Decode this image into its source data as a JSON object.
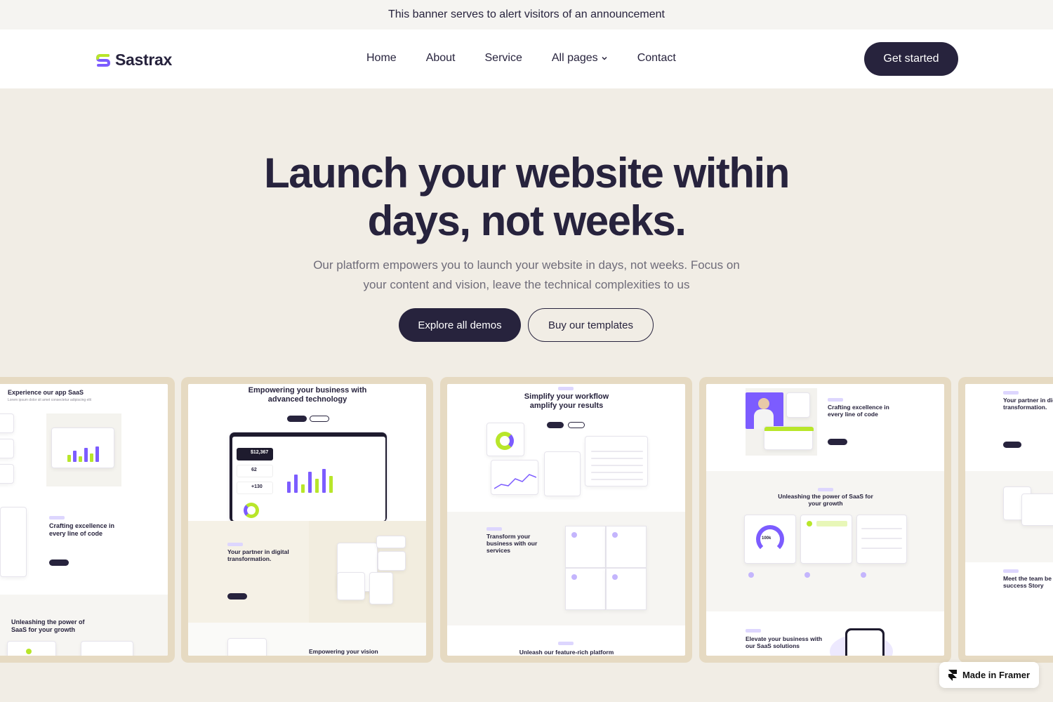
{
  "banner": {
    "text": "This banner serves to alert visitors of an announcement"
  },
  "nav": {
    "brand": "Sastrax",
    "links": [
      "Home",
      "About",
      "Service",
      "All pages",
      "Contact"
    ],
    "cta": "Get started"
  },
  "hero": {
    "title_line1": "Launch your website within",
    "title_line2": "days, not weeks.",
    "subtitle_line1": "Our platform empowers you to launch your website in days, not weeks. Focus on",
    "subtitle_line2": "your content and vision, leave the technical complexities to us",
    "primary_button": "Explore all demos",
    "secondary_button": "Buy our templates"
  },
  "previews": {
    "card1": {
      "title": "Experience our app SaaS",
      "section2": "Crafting excellence in every line of code",
      "section3": "Unleashing the power of SaaS for your growth"
    },
    "card2": {
      "title": "Empowering your business with advanced technology",
      "stat1": "$12,367",
      "stat2": "62",
      "stat3": "+130",
      "section2": "Your partner in digital transformation.",
      "section3": "Empowering your vision"
    },
    "card3": {
      "title": "Simplify your workflow amplify your results",
      "section2": "Transform your business with our services",
      "section3": "Unleash our feature-rich platform"
    },
    "card4": {
      "title": "Crafting excellence in every line of code",
      "section2": "Unleashing the power of SaaS for your growth",
      "stat": "100k",
      "section3": "Elevate your business with our SaaS solutions"
    },
    "card5": {
      "title": "Your partner in digital transformation.",
      "section2": "Meet the team be your success Story"
    }
  },
  "badge": {
    "text": "Made in Framer"
  },
  "colors": {
    "dark": "#27233d",
    "accent_purple": "#7c5cff",
    "accent_lime": "#b8e62a",
    "hero_bg": "#f1ede5",
    "card_frame": "#e6dac2"
  }
}
